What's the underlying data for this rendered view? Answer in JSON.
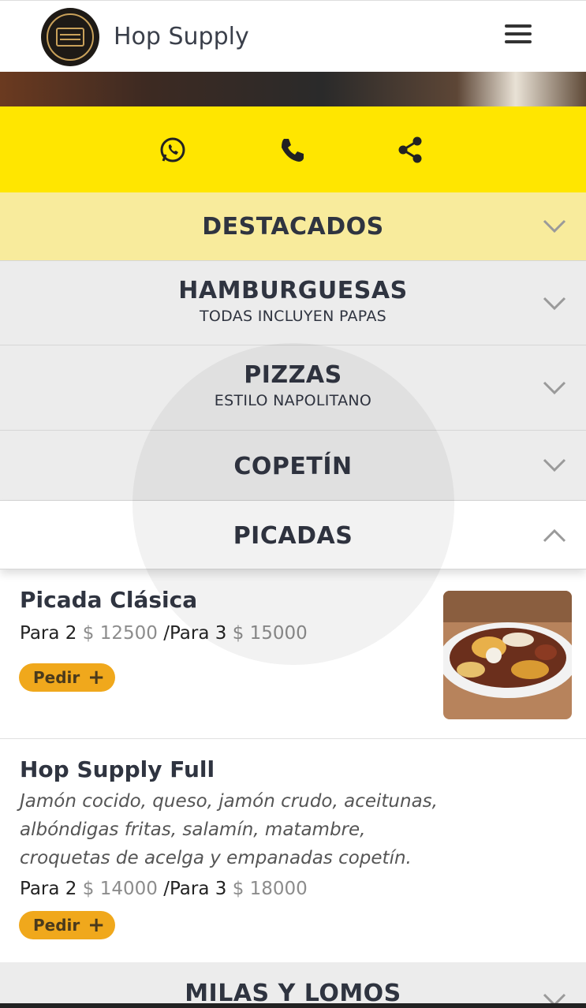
{
  "header": {
    "title": "Hop Supply",
    "logo_text": "THE HOP SUPPLY CO."
  },
  "contact": {
    "icons": [
      "whatsapp-icon",
      "phone-icon",
      "share-icon"
    ]
  },
  "categories": [
    {
      "title": "DESTACADOS",
      "subtitle": ""
    },
    {
      "title": "HAMBURGUESAS",
      "subtitle": "TODAS INCLUYEN PAPAS"
    },
    {
      "title": "PIZZAS",
      "subtitle": "ESTILO NAPOLITANO"
    },
    {
      "title": "COPETÍN",
      "subtitle": ""
    },
    {
      "title": "PICADAS",
      "subtitle": ""
    },
    {
      "title": "MILAS Y LOMOS",
      "subtitle": ""
    }
  ],
  "items": [
    {
      "name": "Picada Clásica",
      "description": "",
      "size1_label": "Para 2",
      "size1_price": "$ 12500",
      "separator": "/",
      "size2_label": "Para 3",
      "size2_price": "$ 15000",
      "order_label": "Pedir"
    },
    {
      "name": "Hop Supply Full",
      "description": "Jamón cocido, queso, jamón crudo, aceitunas, albóndigas fritas, salamín, matambre, croquetas de acelga y empanadas copetín.",
      "size1_label": "Para 2",
      "size1_price": "$ 14000",
      "separator": "/",
      "size2_label": "Para 3",
      "size2_price": "$ 18000",
      "order_label": "Pedir"
    }
  ],
  "colors": {
    "accent_yellow": "#ffe600",
    "featured_bg": "#f8eb9c",
    "order_button": "#f0a81c"
  }
}
